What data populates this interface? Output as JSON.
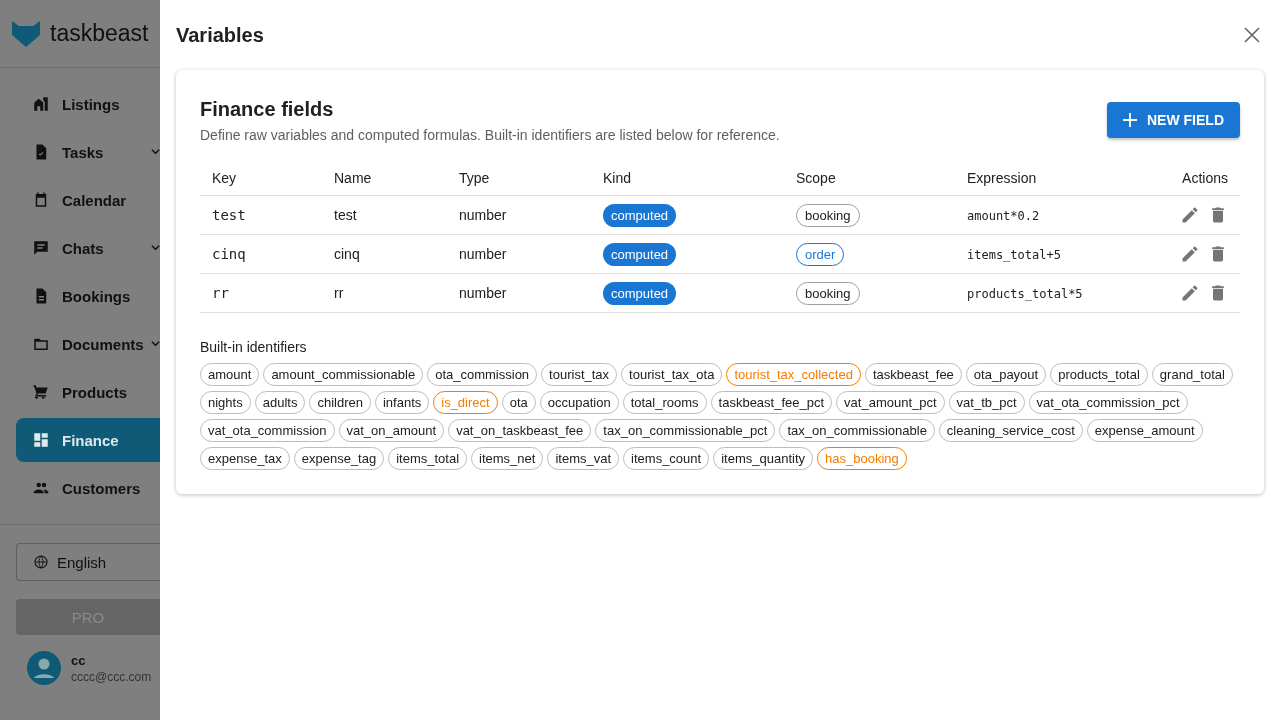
{
  "sidebar": {
    "brand": "taskbeast",
    "items": [
      {
        "label": "Listings",
        "selected": false,
        "expandable": false
      },
      {
        "label": "Tasks",
        "selected": false,
        "expandable": true
      },
      {
        "label": "Calendar",
        "selected": false,
        "expandable": false
      },
      {
        "label": "Chats",
        "selected": false,
        "expandable": true
      },
      {
        "label": "Bookings",
        "selected": false,
        "expandable": false
      },
      {
        "label": "Documents",
        "selected": false,
        "expandable": true
      },
      {
        "label": "Products",
        "selected": false,
        "expandable": false
      },
      {
        "label": "Finance",
        "selected": true,
        "expandable": false
      },
      {
        "label": "Customers",
        "selected": false,
        "expandable": false
      }
    ],
    "language": "English",
    "pro_button": "PRO",
    "user": {
      "name": "cc",
      "email": "cccc@ccc.com"
    }
  },
  "dialog": {
    "title": "Variables",
    "card": {
      "title": "Finance fields",
      "description": "Define raw variables and computed formulas. Built-in identifiers are listed below for reference.",
      "new_button": "NEW FIELD",
      "columns": [
        "Key",
        "Name",
        "Type",
        "Kind",
        "Scope",
        "Expression",
        "Actions"
      ],
      "rows": [
        {
          "key": "test",
          "name": "test",
          "type": "number",
          "kind": "computed",
          "scope": {
            "text": "booking",
            "color": "#9e9e9e"
          },
          "expression": "amount*0.2"
        },
        {
          "key": "cinq",
          "name": "cinq",
          "type": "number",
          "kind": "computed",
          "scope": {
            "text": "order",
            "color": "#1976d2"
          },
          "expression": "items_total+5"
        },
        {
          "key": "rr",
          "name": "rr",
          "type": "number",
          "kind": "computed",
          "scope": {
            "text": "booking",
            "color": "#9e9e9e"
          },
          "expression": "products_total*5"
        }
      ],
      "builtin_title": "Built-in identifiers",
      "identifiers": [
        {
          "text": "amount",
          "highlighted": false
        },
        {
          "text": "amount_commissionable",
          "highlighted": false
        },
        {
          "text": "ota_commission",
          "highlighted": false
        },
        {
          "text": "tourist_tax",
          "highlighted": false
        },
        {
          "text": "tourist_tax_ota",
          "highlighted": false
        },
        {
          "text": "tourist_tax_collected",
          "highlighted": true
        },
        {
          "text": "taskbeast_fee",
          "highlighted": false
        },
        {
          "text": "ota_payout",
          "highlighted": false
        },
        {
          "text": "products_total",
          "highlighted": false
        },
        {
          "text": "grand_total",
          "highlighted": false
        },
        {
          "text": "nights",
          "highlighted": false
        },
        {
          "text": "adults",
          "highlighted": false
        },
        {
          "text": "children",
          "highlighted": false
        },
        {
          "text": "infants",
          "highlighted": false
        },
        {
          "text": "is_direct",
          "highlighted": true
        },
        {
          "text": "ota",
          "highlighted": false
        },
        {
          "text": "occupation",
          "highlighted": false
        },
        {
          "text": "total_rooms",
          "highlighted": false
        },
        {
          "text": "taskbeast_fee_pct",
          "highlighted": false
        },
        {
          "text": "vat_amount_pct",
          "highlighted": false
        },
        {
          "text": "vat_tb_pct",
          "highlighted": false
        },
        {
          "text": "vat_ota_commission_pct",
          "highlighted": false
        },
        {
          "text": "vat_ota_commission",
          "highlighted": false
        },
        {
          "text": "vat_on_amount",
          "highlighted": false
        },
        {
          "text": "vat_on_taskbeast_fee",
          "highlighted": false
        },
        {
          "text": "tax_on_commissionable_pct",
          "highlighted": false
        },
        {
          "text": "tax_on_commissionable",
          "highlighted": false
        },
        {
          "text": "cleaning_service_cost",
          "highlighted": false
        },
        {
          "text": "expense_amount",
          "highlighted": false
        },
        {
          "text": "expense_tax",
          "highlighted": false
        },
        {
          "text": "expense_tag",
          "highlighted": false
        },
        {
          "text": "items_total",
          "highlighted": false
        },
        {
          "text": "items_net",
          "highlighted": false
        },
        {
          "text": "items_vat",
          "highlighted": false
        },
        {
          "text": "items_count",
          "highlighted": false
        },
        {
          "text": "items_quantity",
          "highlighted": false
        },
        {
          "text": "has_booking",
          "highlighted": true
        }
      ]
    }
  }
}
